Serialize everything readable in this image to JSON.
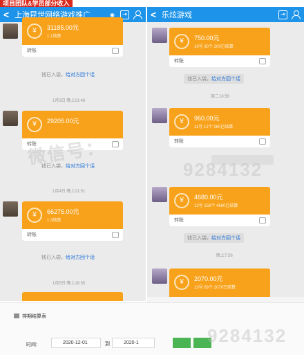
{
  "banner": "项目团队&学员部分收入",
  "left_chat": {
    "title": "上海昆世网络游戏推广",
    "messages": [
      {
        "amount": "31185.00元",
        "sub": "1.1结算",
        "foot": "转账"
      },
      {
        "amount": "29205.00元",
        "sub": "",
        "foot": "转账"
      },
      {
        "amount": "66275.00元",
        "sub": "1.3结算",
        "foot": "转账"
      }
    ],
    "notices": [
      "钱已入袋，",
      "给对方回个话"
    ],
    "times": [
      "1月3日 晚上21:48",
      "1月4日 晚上21:51",
      "1月5日 晚上18:55"
    ]
  },
  "right_chat": {
    "title": "乐炫游戏",
    "messages": [
      {
        "amount": "750.00元",
        "sub": "10号 30个 200已结算",
        "foot": "转账"
      },
      {
        "amount": "960.00元",
        "sub": "11号 12个 960已结算",
        "foot": "转账"
      },
      {
        "amount": "4680.00元",
        "sub": "12号 156个 4680已结算",
        "foot": "转账"
      },
      {
        "amount": "2070.00元",
        "sub": "13号 69个 2070已结算",
        "foot": ""
      }
    ],
    "notices": [
      "钱已入袋，",
      "给对方回个话"
    ],
    "times": [
      "周二18:56",
      "晚上7:58"
    ]
  },
  "bottom_form": {
    "title": "排期结算表",
    "time_label": "时间:",
    "date_start": "2020-12-01",
    "to_label": "到",
    "date_end": "2020-1"
  },
  "watermarks": [
    "微信号：",
    "9284132",
    "9284132"
  ]
}
